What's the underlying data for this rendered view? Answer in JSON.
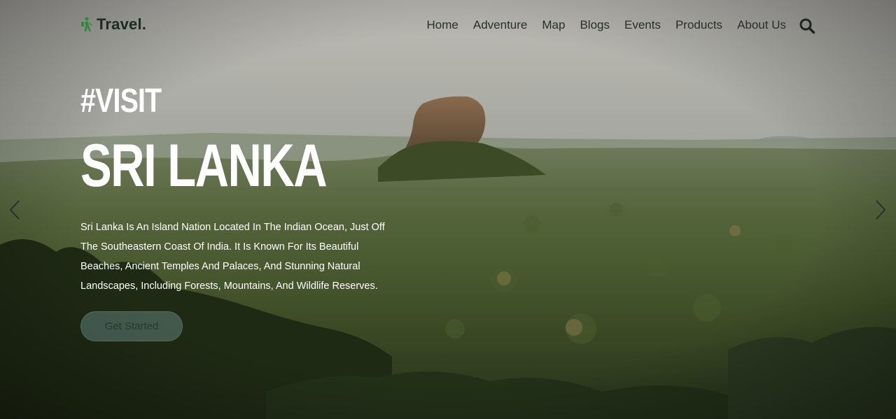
{
  "nav": {
    "logo_text": "Travel.",
    "logo_icon": "hiker-icon",
    "items": [
      {
        "label": "Home"
      },
      {
        "label": "Adventure"
      },
      {
        "label": "Map"
      },
      {
        "label": "Blogs"
      },
      {
        "label": "Events"
      },
      {
        "label": "Products"
      },
      {
        "label": "About Us"
      }
    ],
    "search_icon": "search-icon"
  },
  "hero": {
    "hashtag": "#VISIT",
    "title": "SRI LANKA",
    "description": "Sri Lanka Is An Island Nation Located In The Indian Ocean, Just Off The Southeastern Coast Of India. It Is Known For Its Beautiful Beaches, Ancient Temples And Palaces, And Stunning Natural Landscapes, Including Forests, Mountains, And Wildlife Reserves.",
    "cta_label": "Get Started"
  },
  "carousel": {
    "prev_icon": "chevron-left-icon",
    "next_icon": "chevron-right-icon"
  },
  "colors": {
    "logo_green": "#2e8b3e",
    "text_white": "#ffffff",
    "nav_text": "#2a2f2b",
    "button_fill": "#5f807a"
  }
}
